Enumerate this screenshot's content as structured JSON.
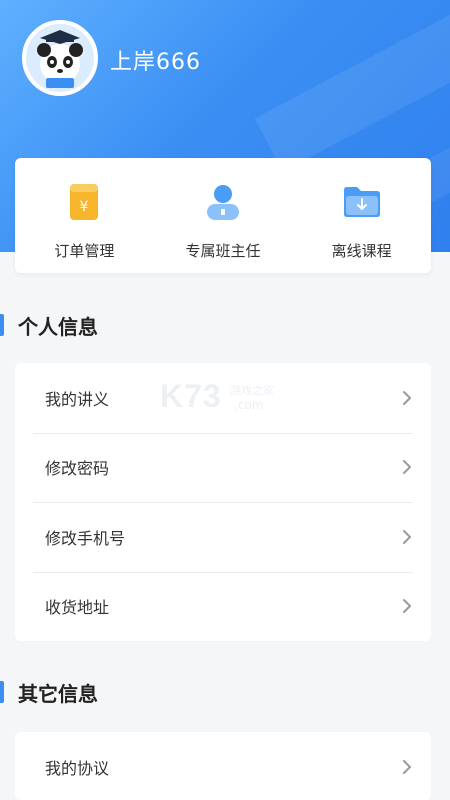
{
  "profile": {
    "username": "上岸666"
  },
  "quick_actions": [
    {
      "label": "订单管理",
      "icon": "wallet-yuan-icon"
    },
    {
      "label": "专属班主任",
      "icon": "user-icon"
    },
    {
      "label": "离线课程",
      "icon": "folder-download-icon"
    }
  ],
  "sections": {
    "personal": {
      "title": "个人信息",
      "items": [
        {
          "label": "我的讲义"
        },
        {
          "label": "修改密码"
        },
        {
          "label": "修改手机号"
        },
        {
          "label": "收货地址"
        }
      ]
    },
    "other": {
      "title": "其它信息",
      "items": [
        {
          "label": "我的协议"
        }
      ]
    }
  },
  "watermark": {
    "brand": "K73",
    "cn": "游戏之家",
    "domain": ".com"
  },
  "colors": {
    "accent": "#3b8ff3",
    "yellow": "#f6b52a"
  }
}
